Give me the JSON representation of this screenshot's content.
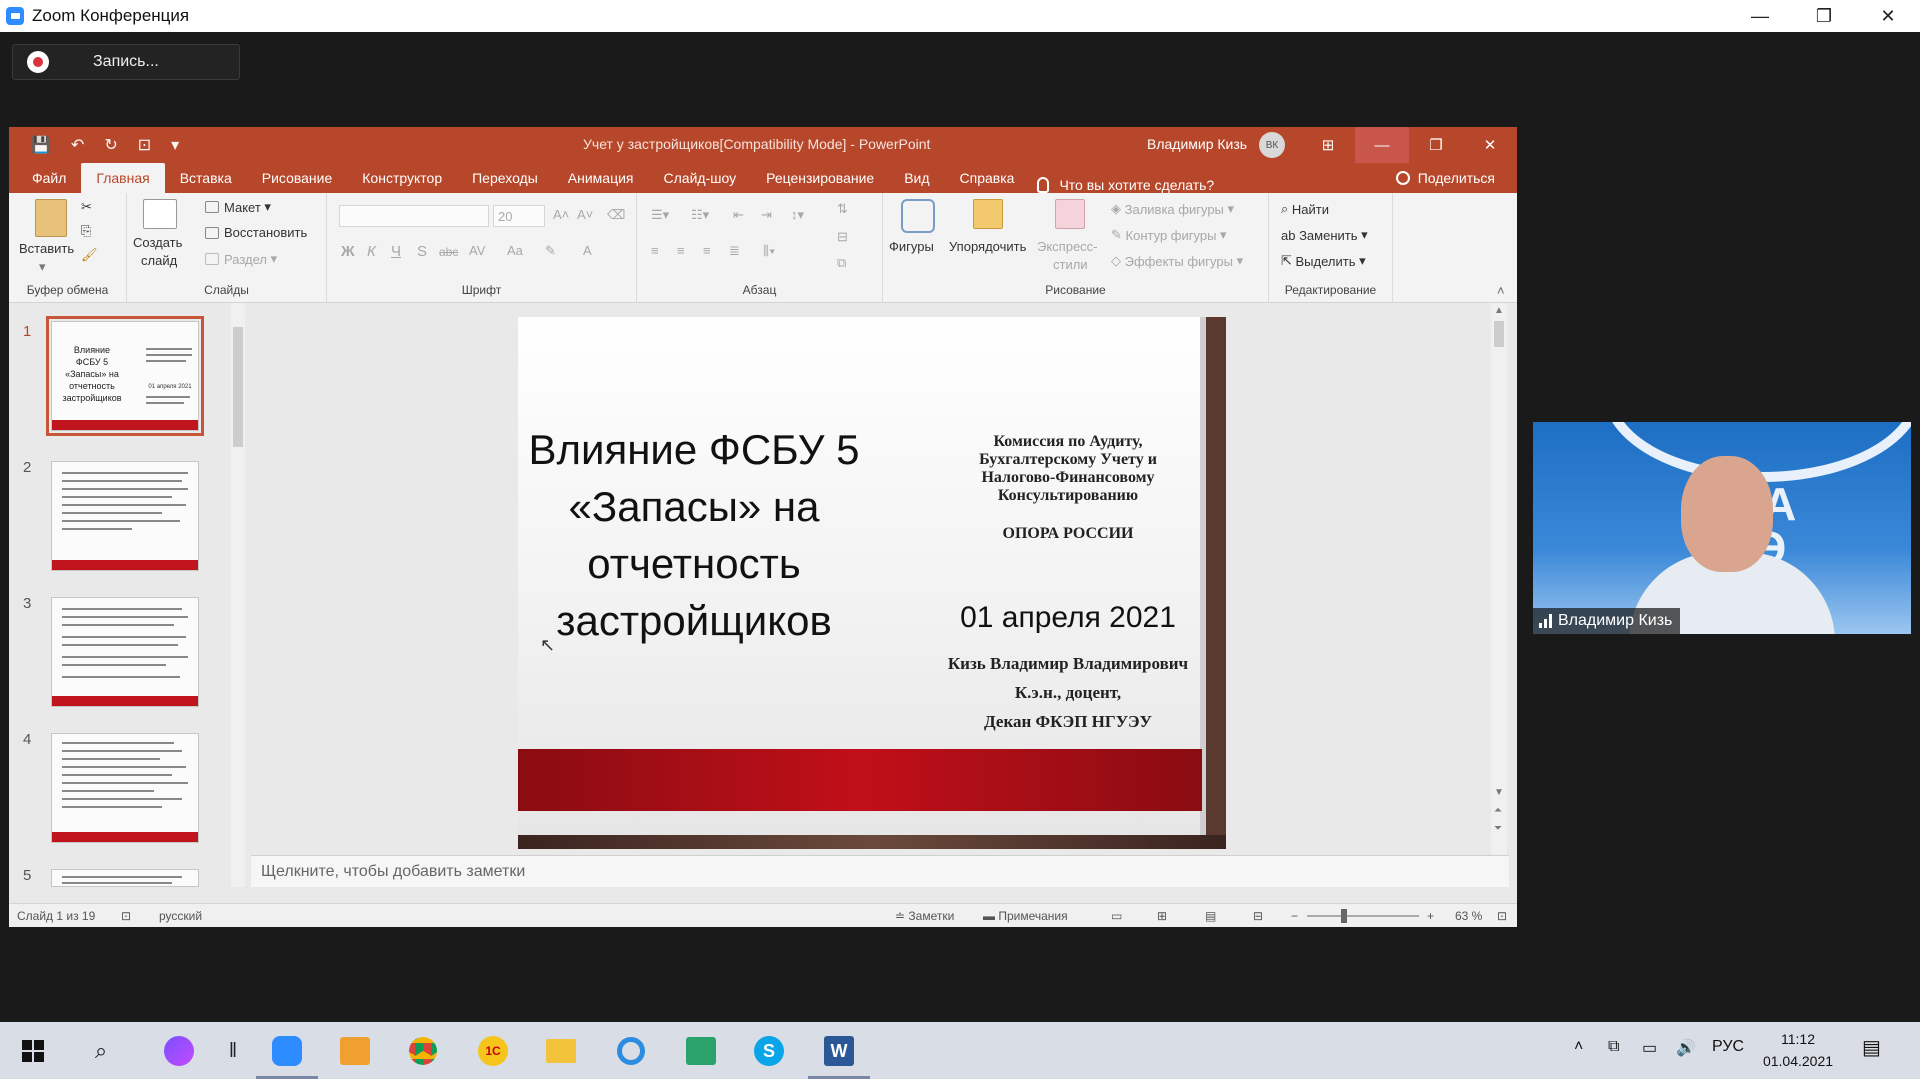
{
  "zoom": {
    "title": "Zoom Конференция",
    "recording_label": "Запись...",
    "window_controls": [
      "—",
      "❐",
      "✕"
    ]
  },
  "powerpoint": {
    "doc_title": "Учет у застройщиков[Compatibility Mode]  -  PowerPoint",
    "user_name": "Владимир Кизь",
    "user_initials": "ВК",
    "tabs": [
      "Файл",
      "Главная",
      "Вставка",
      "Рисование",
      "Конструктор",
      "Переходы",
      "Анимация",
      "Слайд-шоу",
      "Рецензирование",
      "Вид",
      "Справка"
    ],
    "active_tab": "Главная",
    "tell_me": "Что вы хотите сделать?",
    "share": "Поделиться",
    "ribbon": {
      "clipboard": {
        "label": "Буфер обмена",
        "paste": "Вставить"
      },
      "slides": {
        "label": "Слайды",
        "new_slide": "Создать",
        "new_slide_2": "слайд",
        "layout": "Макет",
        "reset": "Восстановить",
        "section": "Раздел"
      },
      "font": {
        "label": "Шрифт",
        "size": "20",
        "bold": "Ж",
        "italic": "К",
        "underline": "Ч",
        "shadow": "S",
        "strike": "abc",
        "spacing": "AV",
        "case": "Aa"
      },
      "paragraph": {
        "label": "Абзац"
      },
      "drawing": {
        "label": "Рисование",
        "shapes": "Фигуры",
        "arrange": "Упорядочить",
        "quick_styles_1": "Экспресс-",
        "quick_styles_2": "стили",
        "fill": "Заливка фигуры",
        "outline": "Контур фигуры",
        "effects": "Эффекты фигуры"
      },
      "editing": {
        "label": "Редактирование",
        "find": "Найти",
        "replace": "Заменить",
        "select": "Выделить"
      }
    },
    "thumbnails": [
      {
        "num": "1",
        "title": "Влияние ФСБУ 5 «Запасы» на отчетность застройщиков",
        "right": "01 апреля 2021"
      },
      {
        "num": "2"
      },
      {
        "num": "3"
      },
      {
        "num": "4"
      },
      {
        "num": "5"
      }
    ],
    "slide": {
      "main_title": "Влияние ФСБУ 5 «Запасы» на отчетность застройщиков",
      "org_1": "Комиссия по Аудиту,",
      "org_2": "Бухгалтерскому Учету и",
      "org_3": "Налогово-Финансовому",
      "org_4": "Консультированию",
      "org_5": "ОПОРА РОССИИ",
      "date": "01 апреля 2021",
      "author_1": "Кизь Владимир Владимирович",
      "author_2": "К.э.н., доцент,",
      "author_3": "Декан ФКЭП НГУЭУ"
    },
    "notes_placeholder": "Щелкните, чтобы добавить заметки",
    "status": {
      "slide_counter": "Слайд 1 из 19",
      "language": "русский",
      "notes": "Заметки",
      "comments": "Примечания",
      "zoom": "63 %"
    }
  },
  "video": {
    "participant_name": "Владимир Кизь",
    "wall_text_1": "ФА",
    "wall_text_2": "КЭ"
  },
  "taskbar": {
    "lang": "РУС",
    "time": "11:12",
    "date": "01.04.2021"
  },
  "colors": {
    "ppt_accent": "#b7472a",
    "slide_band": "#c10f19",
    "zoom_blue": "#2d8cff"
  }
}
